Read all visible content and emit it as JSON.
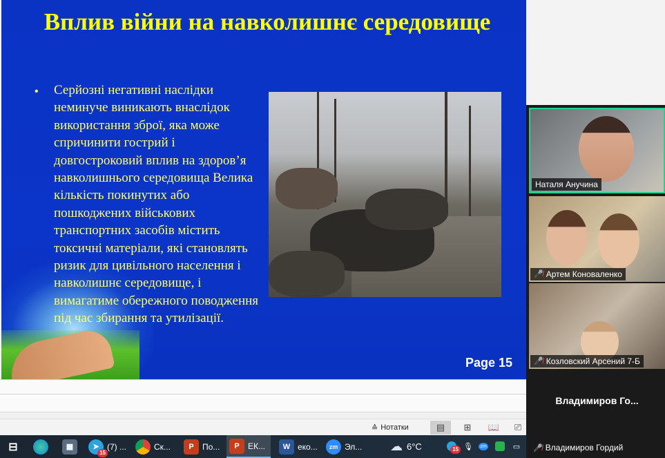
{
  "slide": {
    "title": "Вплив війни на навколишнє середовище",
    "bullet": "Серйозні негативні наслідки неминуче виникають внаслідок використання зброї, яка може спричинити гострий і довгостроковий вплив на здоров’я навколишнього середовища Велика кількість покинутих або пошкоджених військових транспортних засобів містить токсичні матеріали, які становлять ризик для цивільного населення і навколишнє середовище, і вимагатиме обережного поводження під час збирання та утилізації.",
    "page_label": "Page 15"
  },
  "statusbar": {
    "notes_label": "Нотатки"
  },
  "participants": [
    {
      "name": "Наталя Анучина",
      "muted": false
    },
    {
      "name": "Артем Коноваленко",
      "muted": true
    },
    {
      "name": "Козловский Арсений 7-Б",
      "muted": true
    },
    {
      "name": "Владимиров Гордий",
      "muted": true,
      "display": "Владимиров  Го..."
    }
  ],
  "taskbar": {
    "telegram_label": "(7) ...",
    "telegram_badge": "15",
    "chrome_label": "Ск...",
    "ppt1_label": "По...",
    "ppt2_label": "ЕК...",
    "word_label": "еко...",
    "zoom_label": "Эл...",
    "temperature": "6°C",
    "tray_badge": "15"
  },
  "colors": {
    "slide_bg": "#0b35c8",
    "title": "#ffff00",
    "body": "#ffff66",
    "active_speaker": "#23d18b"
  }
}
